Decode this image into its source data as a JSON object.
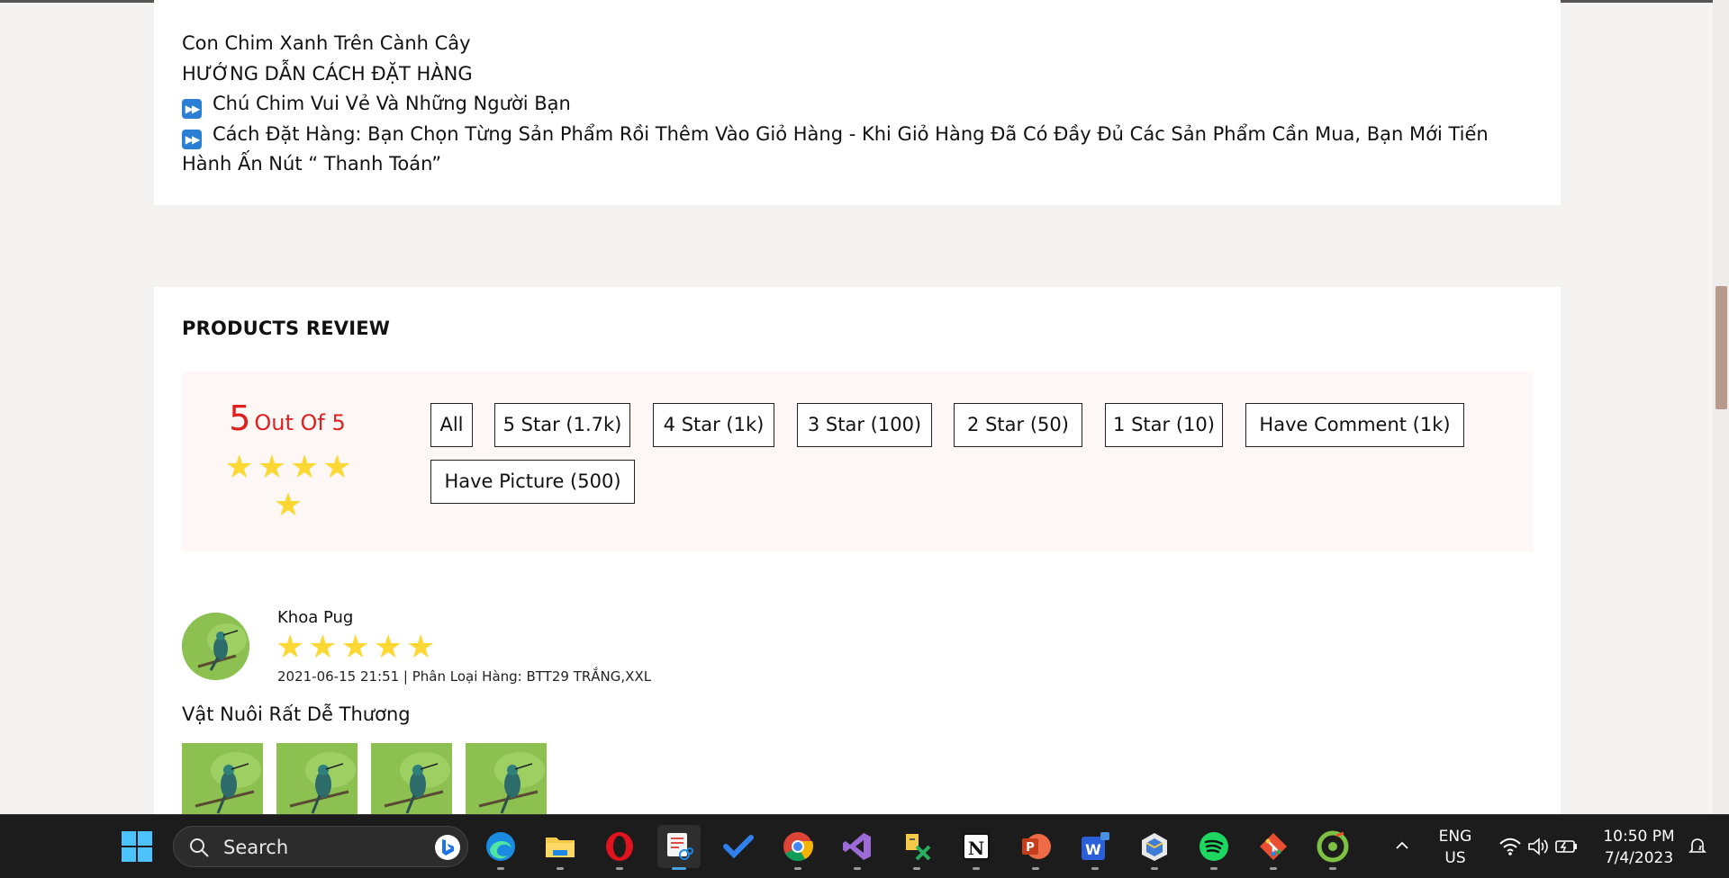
{
  "description": {
    "lines": [
      "Con Chim Xanh Trên Cành Cây",
      "HƯỚNG DẪN CÁCH ĐẶT HÀNG",
      "Chú Chim Vui Vẻ Và Những Người Bạn",
      "Cách Đặt Hàng: Bạn Chọn Từng Sản Phẩm Rồi Thêm Vào Giỏ Hàng - Khi Giỏ Hàng Đã Có Đầy Đủ Các Sản Phẩm Cần Mua, Bạn Mới Tiến Hành Ấn Nút “ Thanh Toán”"
    ],
    "bullet_icon": "fast-forward-icon"
  },
  "review": {
    "title": "PRODUCTS REVIEW",
    "score": "5",
    "score_suffix": "Out Of 5",
    "rating_stars": 5,
    "filters": [
      "All",
      "5 Star (1.7k)",
      "4 Star (1k)",
      "3 Star (100)",
      "2 Star (50)",
      "1 Star (10)",
      "Have Comment (1k)",
      "Have Picture (500)"
    ],
    "items": [
      {
        "name": "Khoa Pug",
        "stars": 5,
        "meta": "2021-06-15 21:51 | Phân Loại Hàng: BTT29 TRẮNG,XXL",
        "comment": "Vật Nuôi Rất Dễ Thương",
        "photo_count": 4
      }
    ]
  },
  "taskbar": {
    "search_placeholder": "Search",
    "lang_line1": "ENG",
    "lang_line2": "US",
    "time": "10:50 PM",
    "date": "7/4/2023",
    "apps": [
      "windows-start-icon",
      "edge-icon",
      "file-explorer-icon",
      "opera-icon",
      "snipping-tool-icon",
      "todo-icon",
      "chrome-icon",
      "visual-studio-icon",
      "xampp-icon",
      "notion-icon",
      "powerpoint-icon",
      "wps-office-icon",
      "virtualbox-icon",
      "spotify-icon",
      "git-icon",
      "coccoc-icon"
    ]
  },
  "colors": {
    "accent_red": "#e01e1e",
    "star_yellow": "#fdd835",
    "summary_bg": "#fdf8f5",
    "page_bg": "#f5f3f1"
  }
}
